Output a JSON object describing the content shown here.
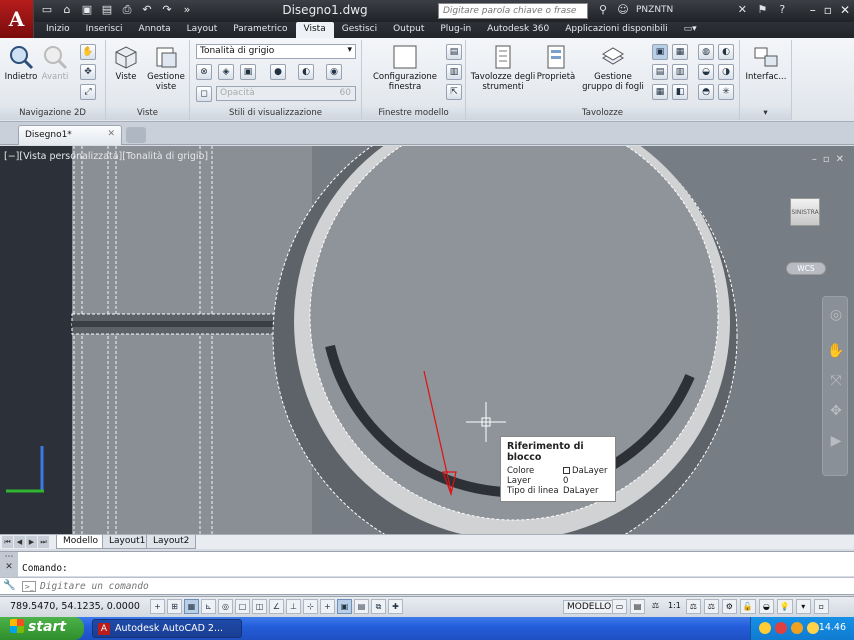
{
  "app": {
    "title": "Disegno1.dwg",
    "search_placeholder": "Digitare parola chiave o frase",
    "user": "PNZNTN"
  },
  "ribbon_tabs": [
    "Inizio",
    "Inserisci",
    "Annota",
    "Layout",
    "Parametrico",
    "Vista",
    "Gestisci",
    "Output",
    "Plug-in",
    "Autodesk 360",
    "Applicazioni disponibili"
  ],
  "ribbon": {
    "nav2d": {
      "back": "Indietro",
      "forward": "Avanti",
      "title": "Navigazione 2D"
    },
    "views": {
      "views_btn": "Viste",
      "manage": "Gestione viste",
      "title": "Viste"
    },
    "visual_styles": {
      "style": "Tonalità di grigio",
      "opacity_placeholder": "Opacità",
      "opacity_value": "60",
      "title": "Stili di visualizzazione"
    },
    "viewports": {
      "config": "Configurazione finestra",
      "title": "Finestre modello"
    },
    "palettes": {
      "tool_palettes": "Tavolozze degli strumenti",
      "properties": "Proprietà",
      "sheet_set": "Gestione gruppo di fogli",
      "title": "Tavolozze"
    },
    "interface": {
      "label": "Interfac..."
    }
  },
  "document_tab": "Disegno1*",
  "viewport": {
    "label": "[−][Vista personalizzata][Tonalità di grigio]",
    "viewcube_face": "SINISTRA",
    "wcs": "WCS"
  },
  "tooltip": {
    "title": "Riferimento di blocco",
    "rows": [
      {
        "key": "Colore",
        "value": "DaLayer",
        "swatch": true
      },
      {
        "key": "Layer",
        "value": "0",
        "swatch": false
      },
      {
        "key": "Tipo di linea",
        "value": "DaLayer",
        "swatch": false
      }
    ]
  },
  "layout_tabs": [
    "Modello",
    "Layout1",
    "Layout2"
  ],
  "command": {
    "history": "Comando:",
    "placeholder": "Digitare un comando"
  },
  "status": {
    "coords": "789.5470, 54.1235, 0.0000",
    "model_label": "MODELLO",
    "scale": "1:1"
  },
  "taskbar": {
    "start": "start",
    "task": "Autodesk AutoCAD 2...",
    "clock": "14.46"
  },
  "colors": {
    "accent_red": "#b61d1d",
    "canvas_bg": "#777d84",
    "arrow": "#e01010"
  }
}
